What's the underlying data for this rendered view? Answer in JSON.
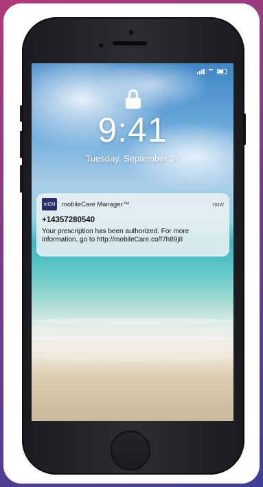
{
  "status_bar": {
    "signal_icon": "cellular-signal-icon",
    "wifi_icon": "wifi-icon",
    "battery_icon": "battery-icon"
  },
  "lock_screen": {
    "lock_icon": "lock-icon",
    "time": "9:41",
    "date": "Tuesday, September 27"
  },
  "notification": {
    "app_icon_text": "mCM",
    "app_name": "mobileCare Manager™",
    "time": "now",
    "sender": "+14357280540",
    "message": "Your prescription has been authorized. For more information, go to  http://mobileCare.co/f7h89j8"
  },
  "colors": {
    "background_gradient": [
      "#b03a7a",
      "#3f3f96"
    ],
    "app_icon": "#27306b"
  }
}
